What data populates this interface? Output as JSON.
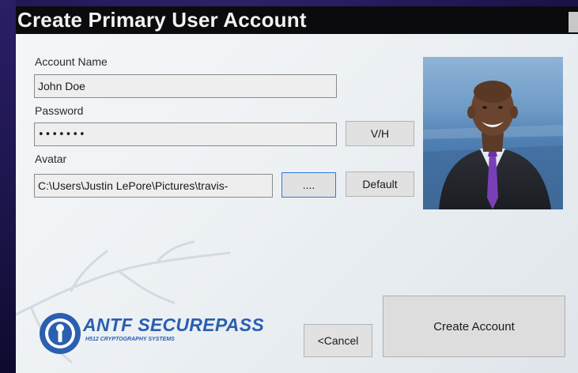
{
  "window": {
    "title": "Create Primary User Account"
  },
  "form": {
    "account_name_label": "Account Name",
    "account_name_value": "John Doe",
    "password_label": "Password",
    "password_value": "•••••••",
    "toggle_visibility_label": "V/H",
    "avatar_label": "Avatar",
    "avatar_path_value": "C:\\Users\\Justin LePore\\Pictures\\travis-",
    "browse_label": "....",
    "default_label": "Default"
  },
  "actions": {
    "cancel_label": "<Cancel",
    "create_label": "Create Account"
  },
  "brand": {
    "name": "ANTF SECUREPASS",
    "tagline": "H512 CRYPTOGRAPHY SYSTEMS"
  },
  "icons": {
    "logo_mark": "keyhole-shield-icon",
    "avatar": "avatar-photo"
  },
  "colors": {
    "title_bar": "#0b0b0d",
    "brand_blue": "#2b5fb0",
    "focus_border": "#2d7bd6",
    "backdrop_purple": "#241a5a"
  }
}
